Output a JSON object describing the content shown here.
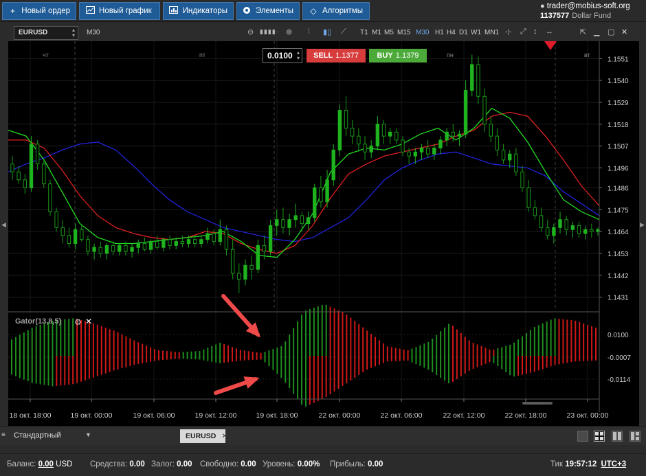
{
  "menu": {
    "new_order": "Новый ордер",
    "new_chart": "Новый график",
    "indicators": "Индикаторы",
    "elements": "Элементы",
    "algorithms": "Алгоритмы"
  },
  "account": {
    "email": "trader@mobius-soft.org",
    "number": "1137577",
    "name": "Dollar Fund"
  },
  "toolbar": {
    "symbol": "EURUSD",
    "timeframe": "M30",
    "timeframes": [
      "T1",
      "M1",
      "M5",
      "M15",
      "M30",
      "H1",
      "H4",
      "D1",
      "W1",
      "MN1"
    ],
    "active_timeframe": "M30"
  },
  "trade": {
    "lot": "0.0100",
    "sell_label": "SELL",
    "sell_price": "1.1377",
    "buy_label": "BUY",
    "buy_price": "1.1379"
  },
  "chart": {
    "day_labels": [
      "чт",
      "пт",
      "пн",
      "вт"
    ],
    "price_ticks": [
      "1.1551",
      "1.1540",
      "1.1529",
      "1.1518",
      "1.1507",
      "1.1496",
      "1.1486",
      "1.1475",
      "1.1464",
      "1.1453",
      "1.1442",
      "1.1431"
    ],
    "time_ticks": [
      "18 окт. 18:00",
      "19 окт. 00:00",
      "19 окт. 06:00",
      "19 окт. 12:00",
      "19 окт. 18:00",
      "22 окт. 00:00",
      "22 окт. 06:00",
      "22 окт. 12:00",
      "22 окт. 18:00",
      "23 окт. 00:00"
    ],
    "colors": {
      "up": "#1fb31f",
      "down": "#ff2a2a",
      "jaw": "#2222dd",
      "teeth": "#e02020",
      "lips": "#22dd22",
      "bg": "#000000"
    }
  },
  "gator": {
    "label": "Gator(13,8,5)",
    "ticks": [
      "0.0100",
      "-0.0007",
      "-0.0114"
    ]
  },
  "chart_data": {
    "type": "candlestick",
    "price_ylim": [
      1.1425,
      1.1558
    ],
    "candles": [
      [
        1.1498,
        1.1502,
        1.149,
        1.1494
      ],
      [
        1.1494,
        1.1497,
        1.1488,
        1.149
      ],
      [
        1.149,
        1.1493,
        1.1483,
        1.1486
      ],
      [
        1.1486,
        1.1512,
        1.1484,
        1.1508
      ],
      [
        1.1508,
        1.151,
        1.1495,
        1.1498
      ],
      [
        1.1498,
        1.15,
        1.1486,
        1.1488
      ],
      [
        1.1488,
        1.149,
        1.1472,
        1.1474
      ],
      [
        1.1474,
        1.1476,
        1.1464,
        1.1466
      ],
      [
        1.1466,
        1.147,
        1.1458,
        1.1462
      ],
      [
        1.1462,
        1.1466,
        1.1456,
        1.1458
      ],
      [
        1.1458,
        1.1468,
        1.1455,
        1.1465
      ],
      [
        1.1465,
        1.1467,
        1.1459,
        1.146
      ],
      [
        1.146,
        1.1462,
        1.1452,
        1.1454
      ],
      [
        1.1454,
        1.1458,
        1.145,
        1.1456
      ],
      [
        1.1456,
        1.1459,
        1.1451,
        1.1453
      ],
      [
        1.1453,
        1.1458,
        1.145,
        1.1457
      ],
      [
        1.1457,
        1.1459,
        1.1452,
        1.1454
      ],
      [
        1.1454,
        1.1458,
        1.1452,
        1.1457
      ],
      [
        1.1457,
        1.1459,
        1.1452,
        1.1454
      ],
      [
        1.1454,
        1.1458,
        1.1451,
        1.1456
      ],
      [
        1.1456,
        1.146,
        1.1453,
        1.1458
      ],
      [
        1.1458,
        1.1461,
        1.1454,
        1.1455
      ],
      [
        1.1455,
        1.146,
        1.1453,
        1.1459
      ],
      [
        1.1459,
        1.1462,
        1.1455,
        1.1456
      ],
      [
        1.1456,
        1.1461,
        1.1454,
        1.146
      ],
      [
        1.146,
        1.1462,
        1.1455,
        1.1457
      ],
      [
        1.1457,
        1.1461,
        1.1455,
        1.1459
      ],
      [
        1.1459,
        1.1462,
        1.1456,
        1.1458
      ],
      [
        1.1458,
        1.1462,
        1.1456,
        1.146
      ],
      [
        1.146,
        1.1462,
        1.1456,
        1.1458
      ],
      [
        1.1458,
        1.1462,
        1.1456,
        1.146
      ],
      [
        1.146,
        1.1466,
        1.1458,
        1.1463
      ],
      [
        1.1463,
        1.1465,
        1.1457,
        1.1459
      ],
      [
        1.1459,
        1.147,
        1.1457,
        1.1465
      ],
      [
        1.1465,
        1.1467,
        1.1452,
        1.1455
      ],
      [
        1.1455,
        1.146,
        1.144,
        1.1443
      ],
      [
        1.1443,
        1.1448,
        1.1433,
        1.144
      ],
      [
        1.144,
        1.145,
        1.1437,
        1.1447
      ],
      [
        1.1447,
        1.1452,
        1.144,
        1.1445
      ],
      [
        1.1445,
        1.146,
        1.1443,
        1.1457
      ],
      [
        1.1457,
        1.1462,
        1.145,
        1.1454
      ],
      [
        1.1454,
        1.147,
        1.1452,
        1.1467
      ],
      [
        1.1467,
        1.1475,
        1.1462,
        1.147
      ],
      [
        1.147,
        1.1476,
        1.1463,
        1.1466
      ],
      [
        1.1466,
        1.1473,
        1.1462,
        1.147
      ],
      [
        1.147,
        1.1478,
        1.1466,
        1.1472
      ],
      [
        1.1472,
        1.1474,
        1.1464,
        1.1468
      ],
      [
        1.1468,
        1.1474,
        1.1465,
        1.1471
      ],
      [
        1.1471,
        1.1488,
        1.1469,
        1.1486
      ],
      [
        1.1486,
        1.1492,
        1.1476,
        1.1479
      ],
      [
        1.1479,
        1.1495,
        1.1476,
        1.149
      ],
      [
        1.149,
        1.1508,
        1.1487,
        1.1505
      ],
      [
        1.1505,
        1.1528,
        1.1502,
        1.1525
      ],
      [
        1.1525,
        1.1532,
        1.1512,
        1.1516
      ],
      [
        1.1516,
        1.152,
        1.1508,
        1.1512
      ],
      [
        1.1512,
        1.1516,
        1.1504,
        1.1508
      ],
      [
        1.1508,
        1.1512,
        1.15,
        1.1504
      ],
      [
        1.1504,
        1.151,
        1.1501,
        1.1507
      ],
      [
        1.1507,
        1.1522,
        1.1505,
        1.1518
      ],
      [
        1.1518,
        1.152,
        1.1508,
        1.1512
      ],
      [
        1.1512,
        1.1516,
        1.1508,
        1.1514
      ],
      [
        1.1514,
        1.1516,
        1.1508,
        1.151
      ],
      [
        1.151,
        1.1512,
        1.1502,
        1.1504
      ],
      [
        1.1504,
        1.1506,
        1.1498,
        1.1502
      ],
      [
        1.1502,
        1.1506,
        1.1498,
        1.1504
      ],
      [
        1.1504,
        1.1508,
        1.15,
        1.1506
      ],
      [
        1.1506,
        1.151,
        1.1501,
        1.1503
      ],
      [
        1.1503,
        1.1508,
        1.15,
        1.1506
      ],
      [
        1.1506,
        1.1512,
        1.1503,
        1.151
      ],
      [
        1.151,
        1.1516,
        1.1507,
        1.1514
      ],
      [
        1.1514,
        1.1518,
        1.1509,
        1.1512
      ],
      [
        1.1512,
        1.1515,
        1.1507,
        1.1513
      ],
      [
        1.1513,
        1.154,
        1.1511,
        1.1535
      ],
      [
        1.1535,
        1.1553,
        1.1532,
        1.1548
      ],
      [
        1.1548,
        1.1552,
        1.1528,
        1.1532
      ],
      [
        1.1532,
        1.1536,
        1.1514,
        1.1518
      ],
      [
        1.1518,
        1.1522,
        1.1509,
        1.1512
      ],
      [
        1.1512,
        1.1516,
        1.1502,
        1.1505
      ],
      [
        1.1505,
        1.1508,
        1.1498,
        1.15
      ],
      [
        1.15,
        1.1505,
        1.1496,
        1.1503
      ],
      [
        1.1503,
        1.1506,
        1.1492,
        1.1494
      ],
      [
        1.1494,
        1.1497,
        1.1484,
        1.1486
      ],
      [
        1.1486,
        1.149,
        1.1474,
        1.1476
      ],
      [
        1.1476,
        1.148,
        1.147,
        1.1472
      ],
      [
        1.1472,
        1.1476,
        1.1464,
        1.1466
      ],
      [
        1.1466,
        1.147,
        1.146,
        1.1462
      ],
      [
        1.1462,
        1.1468,
        1.1458,
        1.1466
      ],
      [
        1.1466,
        1.1474,
        1.1463,
        1.147
      ],
      [
        1.147,
        1.1472,
        1.1462,
        1.1465
      ],
      [
        1.1465,
        1.1469,
        1.1461,
        1.1467
      ],
      [
        1.1467,
        1.1469,
        1.1461,
        1.1463
      ],
      [
        1.1463,
        1.1467,
        1.146,
        1.1465
      ],
      [
        1.1465,
        1.1468,
        1.1461,
        1.1464
      ],
      [
        1.1464,
        1.1466,
        1.1462,
        1.1465
      ]
    ],
    "jaw": [
      1.1494,
      1.1498,
      1.1501,
      1.1505,
      1.1508,
      1.1509,
      1.1505,
      1.1497,
      1.1488,
      1.148,
      1.1474,
      1.147,
      1.1466,
      1.1464,
      1.1462,
      1.146,
      1.1459,
      1.1461,
      1.1466,
      1.1471,
      1.148,
      1.149,
      1.1496,
      1.15,
      1.1503,
      1.1504,
      1.1501,
      1.1498,
      1.1497,
      1.1496,
      1.1492,
      1.1484,
      1.1478,
      1.1472
    ],
    "teeth": [
      1.151,
      1.151,
      1.1506,
      1.1495,
      1.1482,
      1.1472,
      1.1466,
      1.1463,
      1.1461,
      1.146,
      1.1461,
      1.1464,
      1.1463,
      1.1458,
      1.1455,
      1.1453,
      1.1457,
      1.1467,
      1.1481,
      1.1493,
      1.1498,
      1.1502,
      1.1504,
      1.1506,
      1.1508,
      1.1512,
      1.1515,
      1.1522,
      1.1524,
      1.1522,
      1.1512,
      1.15,
      1.1487,
      1.1477
    ],
    "lips": [
      1.1515,
      1.1512,
      1.15,
      1.1484,
      1.1468,
      1.1461,
      1.1458,
      1.1458,
      1.1459,
      1.146,
      1.1461,
      1.1462,
      1.1464,
      1.1459,
      1.1452,
      1.1451,
      1.146,
      1.1473,
      1.1494,
      1.1503,
      1.1506,
      1.1505,
      1.1508,
      1.1513,
      1.1516,
      1.151,
      1.1516,
      1.1526,
      1.1521,
      1.1509,
      1.1494,
      1.148,
      1.1474,
      1.147
    ],
    "gator_upper": [
      0.0035,
      0.006,
      0.0075,
      0.008,
      0.0068,
      0.0052,
      0.003,
      0.0012,
      0.0008,
      0.001,
      0.0028,
      0.0012,
      0.0006,
      0.0022,
      0.0095,
      0.011,
      0.009,
      0.0055,
      0.002,
      0.0012,
      0.003,
      0.007,
      0.003,
      0.0012,
      0.0025,
      0.006,
      0.008,
      0.0075,
      0.006
    ],
    "gator_lower": [
      0.004,
      0.0058,
      0.0065,
      0.006,
      0.0045,
      0.003,
      0.0018,
      0.001,
      0.0006,
      0.0008,
      0.0016,
      0.001,
      0.0008,
      0.005,
      0.011,
      0.009,
      0.006,
      0.003,
      0.0012,
      0.001,
      0.003,
      0.006,
      0.003,
      0.0012,
      0.0045,
      0.0035,
      0.002,
      0.0012,
      0.001
    ]
  },
  "tabs": {
    "workspace": "Стандартный",
    "chart_tab": "EURUSD"
  },
  "status": {
    "balance_label": "Баланс:",
    "balance_value": "0.00",
    "currency": "USD",
    "funds_label": "Средства:",
    "funds_value": "0.00",
    "margin_label": "Залог:",
    "margin_value": "0.00",
    "free_label": "Свободно:",
    "free_value": "0.00",
    "level_label": "Уровень:",
    "level_value": "0.00%",
    "profit_label": "Прибыль:",
    "profit_value": "0.00",
    "tick_label": "Тик",
    "tick_time": "19:57:12",
    "timezone": "UTC+3"
  }
}
